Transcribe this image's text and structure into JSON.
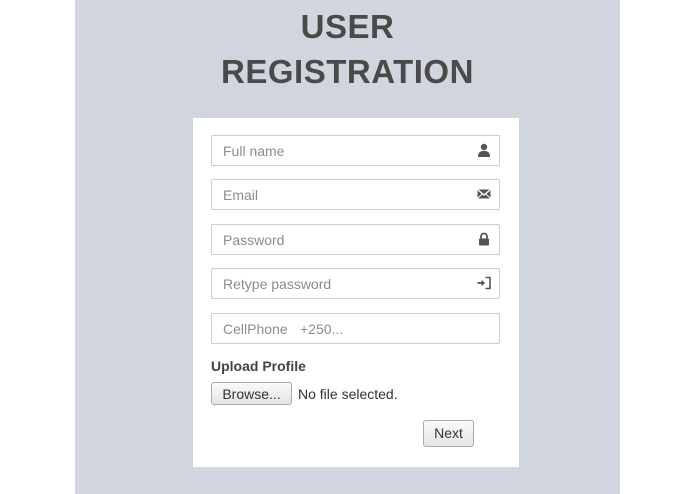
{
  "header": {
    "title_line1": "USER",
    "title_line2": "REGISTRATION"
  },
  "form": {
    "fields": [
      {
        "placeholder": "Full name",
        "icon": "user-icon"
      },
      {
        "placeholder": "Email",
        "icon": "envelope-icon"
      },
      {
        "placeholder": "Password",
        "icon": "lock-icon"
      },
      {
        "placeholder": "Retype password",
        "icon": "sign-in-icon"
      },
      {
        "placeholder": "CellPhone",
        "hint": "+250...",
        "icon": null
      }
    ],
    "upload_label": "Upload Profile",
    "browse_label": "Browse...",
    "file_status": "No file selected.",
    "next_label": "Next"
  },
  "colors": {
    "page_bg": "#d1d5de",
    "card_bg": "#ffffff",
    "title": "#4a4a4a",
    "placeholder": "#8c8c8c",
    "icon": "#555555"
  }
}
